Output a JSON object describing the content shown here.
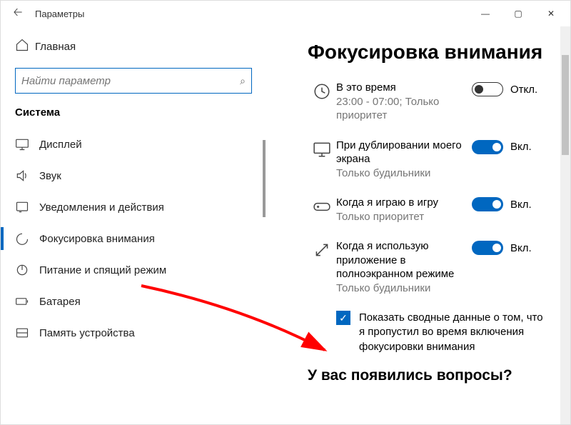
{
  "window": {
    "title": "Параметры"
  },
  "sidebar": {
    "home": "Главная",
    "search_placeholder": "Найти параметр",
    "category": "Система",
    "items": [
      {
        "label": "Дисплей"
      },
      {
        "label": "Звук"
      },
      {
        "label": "Уведомления и действия"
      },
      {
        "label": "Фокусировка внимания"
      },
      {
        "label": "Питание и спящий режим"
      },
      {
        "label": "Батарея"
      },
      {
        "label": "Память устройства"
      }
    ]
  },
  "main": {
    "heading": "Фокусировка внимания",
    "rules": [
      {
        "title": "В это время",
        "sub": "23:00 - 07:00; Только приоритет",
        "toggle": "off",
        "tlabel": "Откл."
      },
      {
        "title": "При дублировании моего экрана",
        "sub": "Только будильники",
        "toggle": "on",
        "tlabel": "Вкл."
      },
      {
        "title": "Когда я играю в игру",
        "sub": "Только приоритет",
        "toggle": "on",
        "tlabel": "Вкл."
      },
      {
        "title": "Когда я использую приложение в полноэкранном режиме",
        "sub": "Только будильники",
        "toggle": "on",
        "tlabel": "Вкл."
      }
    ],
    "checkbox_label": "Показать сводные данные о том, что я пропустил во время включения фокусировки внимания",
    "question_heading": "У вас появились вопросы?"
  }
}
